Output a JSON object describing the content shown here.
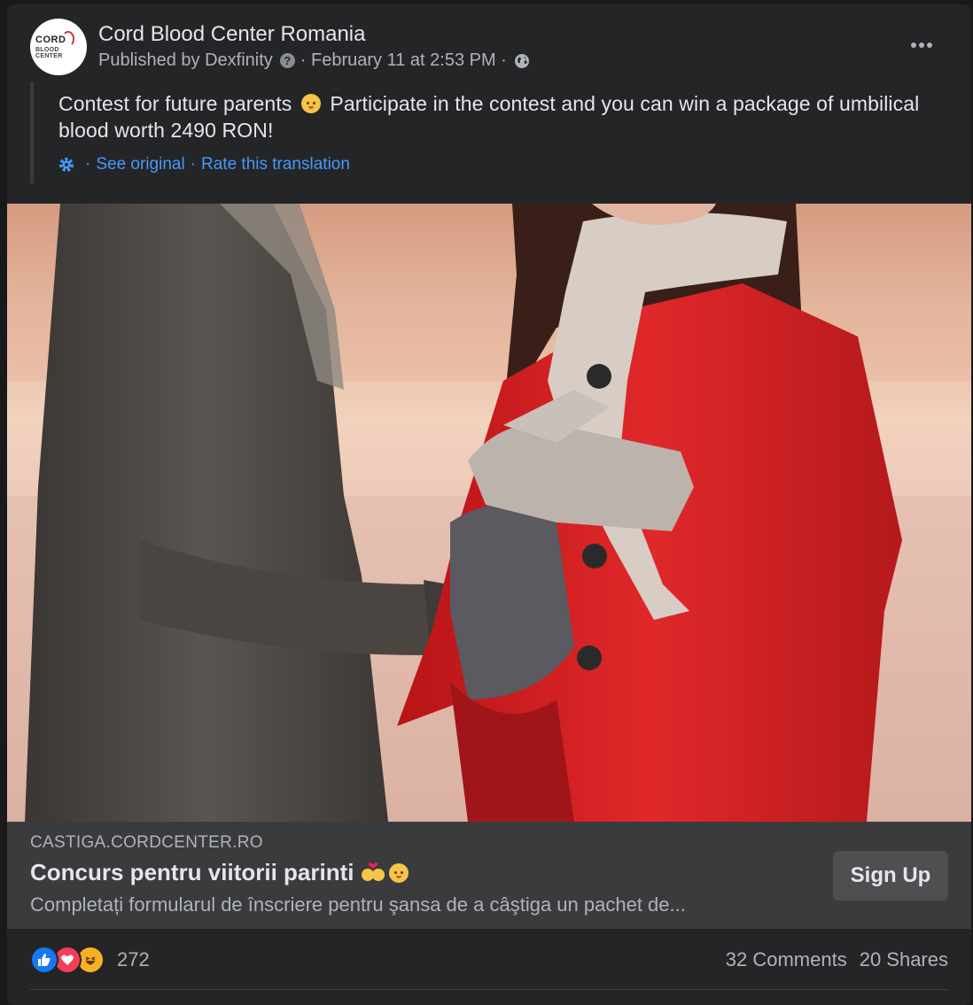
{
  "post": {
    "page_name": "Cord Blood Center Romania",
    "published_by": "Published by Dexfinity",
    "date": "February 11 at 2:53 PM",
    "text_part1": "Contest for future parents",
    "text_part2": "Participate in the contest and you can win a package of umbilical blood worth 2490 RON!",
    "see_original": "See original",
    "rate_translation": "Rate this translation",
    "avatar_logo_line1": "CORD",
    "avatar_logo_line2": "BLOOD CENTER"
  },
  "link_preview": {
    "domain": "CASTIGA.CORDCENTER.RO",
    "title": "Concurs pentru viitorii parinti",
    "description": "Completați formularul de înscriere pentru şansa de a câştiga un pachet de...",
    "cta_label": "Sign Up"
  },
  "footer": {
    "reaction_count": "272",
    "comments": "32 Comments",
    "shares": "20 Shares"
  },
  "icons": {
    "more": "more-icon",
    "help": "help-icon",
    "globe": "globe-icon",
    "gear": "gear-icon",
    "like": "like-reaction-icon",
    "love": "love-reaction-icon",
    "haha": "haha-reaction-icon"
  },
  "colors": {
    "background": "#18191a",
    "card": "#242526",
    "link_box": "#3a3b3c",
    "link_text": "#4599ff",
    "coat_red": "#d01f1f"
  }
}
